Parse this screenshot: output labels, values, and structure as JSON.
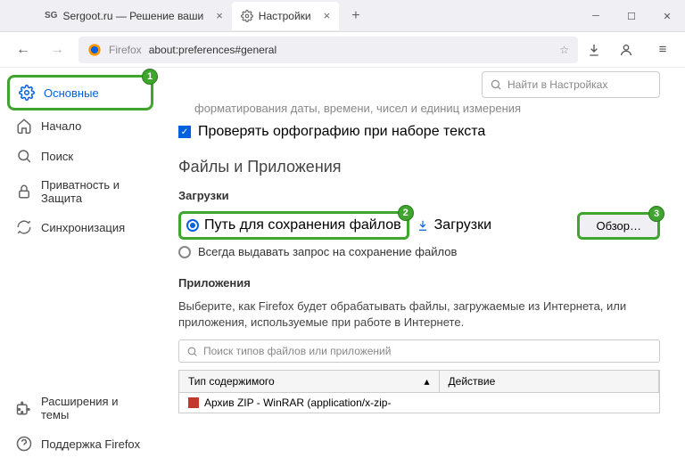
{
  "tabs": {
    "t1": "Sergoot.ru — Решение ваши",
    "t2": "Настройки"
  },
  "url": {
    "label": "Firefox",
    "path": "about:preferences#general"
  },
  "search_settings_placeholder": "Найти в Настройках",
  "sidebar": {
    "general": "Основные",
    "home": "Начало",
    "search": "Поиск",
    "privacy": "Приватность и Защита",
    "sync": "Синхронизация",
    "extensions": "Расширения и темы",
    "support": "Поддержка Firefox"
  },
  "main": {
    "truncated_line": "форматирования даты, времени, чисел и единиц измерения",
    "spellcheck": "Проверять орфографию при наборе текста",
    "files_apps_title": "Файлы и Приложения",
    "downloads_title": "Загрузки",
    "save_to_label": "Путь для сохранения файлов",
    "downloads_folder": "Загрузки",
    "browse_btn": "Обзор…",
    "always_ask": "Всегда выдавать запрос на сохранение файлов",
    "apps_title": "Приложения",
    "apps_desc": "Выберите, как Firefox будет обрабатывать файлы, загружаемые из Интернета, или приложения, используемые при работе в Интернете.",
    "apps_filter_placeholder": "Поиск типов файлов или приложений",
    "table": {
      "col1": "Тип содержимого",
      "col2": "Действие",
      "row1": "Архив ZIP - WinRAR (application/x-zip-"
    }
  },
  "callouts": {
    "c1": "1",
    "c2": "2",
    "c3": "3"
  }
}
